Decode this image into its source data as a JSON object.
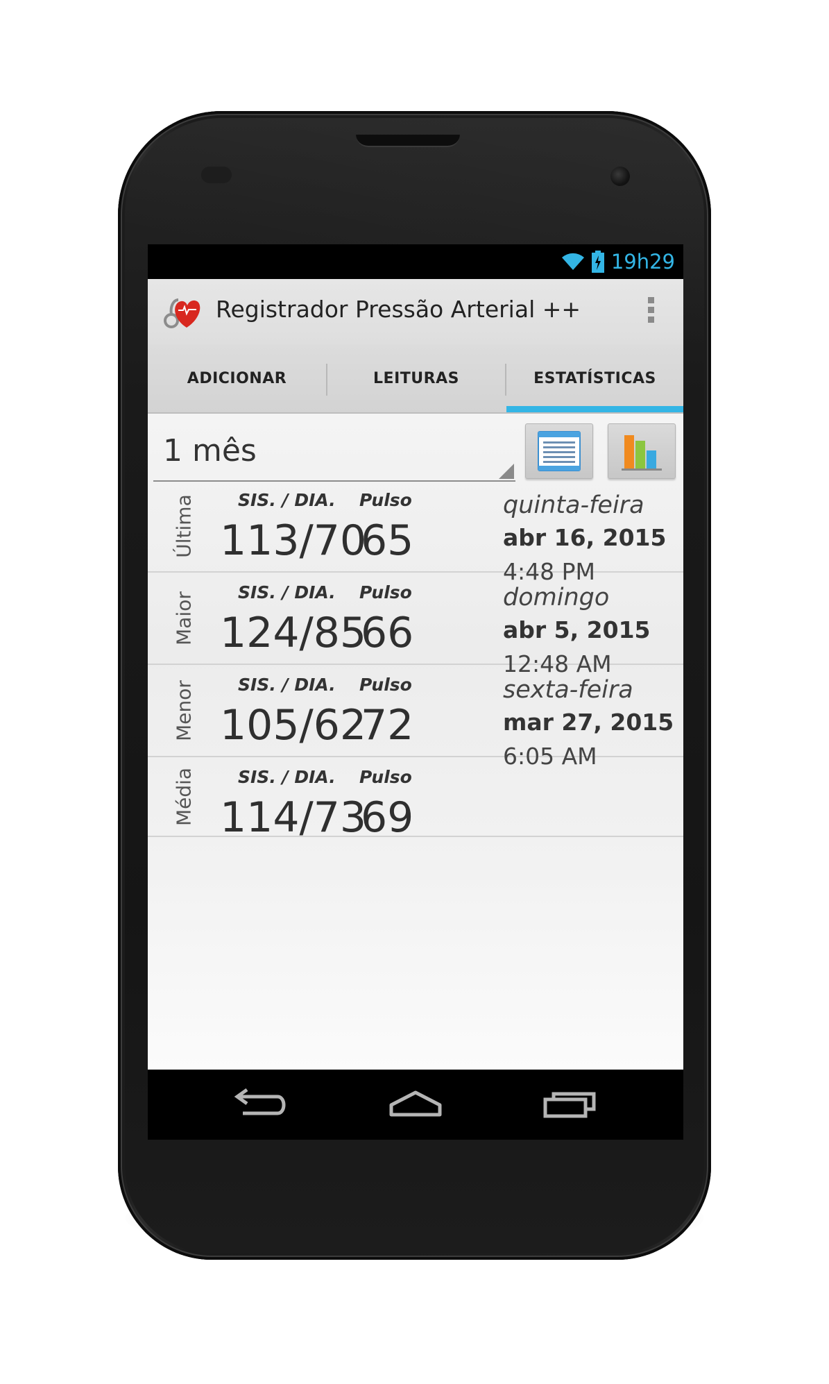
{
  "status_bar": {
    "time": "19h29",
    "icons": [
      "wifi-icon",
      "battery-charging-icon"
    ],
    "accent_color": "#33b5e5"
  },
  "action_bar": {
    "app_title": "Registrador Pressão Arterial ++",
    "icon": "heart-stethoscope-icon",
    "overflow_icon": "overflow-menu-icon"
  },
  "tabs": [
    {
      "label": "ADICIONAR",
      "selected": false
    },
    {
      "label": "LEITURAS",
      "selected": false
    },
    {
      "label": "ESTATÍSTICAS",
      "selected": true
    }
  ],
  "filter": {
    "period_selected": "1 mês",
    "buttons": [
      "list-view-icon",
      "bar-chart-icon"
    ]
  },
  "column_headers": {
    "pressure": "SIS. / DIA.",
    "pulse": "Pulso"
  },
  "rows": [
    {
      "label": "Última",
      "pressure": "113/70",
      "pulse": "65",
      "weekday": "quinta-feira",
      "date": "abr 16, 2015",
      "time": "4:48 PM"
    },
    {
      "label": "Maior",
      "pressure": "124/85",
      "pulse": "66",
      "weekday": "domingo",
      "date": "abr 5, 2015",
      "time": "12:48 AM"
    },
    {
      "label": "Menor",
      "pressure": "105/62",
      "pulse": "72",
      "weekday": "sexta-feira",
      "date": "mar 27, 2015",
      "time": "6:05 AM"
    },
    {
      "label": "Média",
      "pressure": "114/73",
      "pulse": "69",
      "weekday": "",
      "date": "",
      "time": ""
    }
  ],
  "nav_bar": [
    "back-icon",
    "home-icon",
    "recent-apps-icon"
  ]
}
